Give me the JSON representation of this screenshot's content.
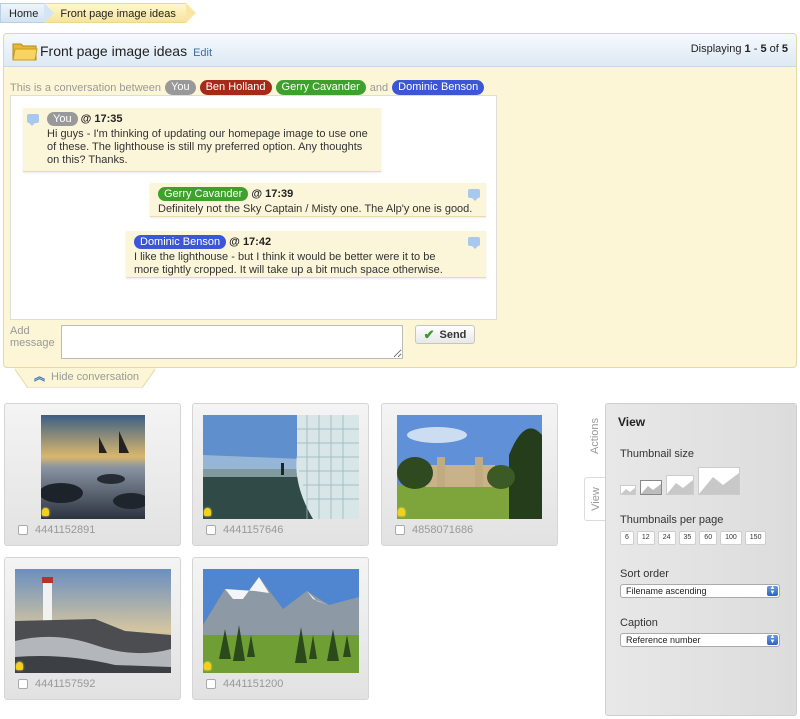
{
  "breadcrumb": {
    "home": "Home",
    "current": "Front page image ideas"
  },
  "conversation": {
    "title": "Front page image ideas",
    "edit_label": "Edit",
    "displaying_prefix": "Displaying",
    "displaying_from": "1",
    "displaying_dash": "-",
    "displaying_to": "5",
    "displaying_of": "of",
    "displaying_total": "5",
    "participants_intro": "This is a conversation between",
    "participants_and": "and",
    "participants": [
      {
        "name": "You",
        "color": "#999999"
      },
      {
        "name": "Ben Holland",
        "color": "#a52a1a"
      },
      {
        "name": "Gerry Cavander",
        "color": "#3fa12d"
      },
      {
        "name": "Dominic Benson",
        "color": "#3d56d6"
      }
    ],
    "messages": [
      {
        "author": "You",
        "time": "@ 17:35",
        "text": "Hi guys - I'm thinking of updating our homepage image to use one of these. The lighthouse is still my preferred option. Any thoughts on this? Thanks."
      },
      {
        "author": "Gerry Cavander",
        "time": "@ 17:39",
        "text": "Definitely not the Sky Captain / Misty one. The Alp'y one is good."
      },
      {
        "author": "Dominic Benson",
        "time": "@ 17:42",
        "text": "I like the lighthouse - but I think it would be better were it to be more tightly cropped. It will take up a bit much space otherwise."
      }
    ],
    "add_message_label": "Add message",
    "message_value": "",
    "send_label": "Send",
    "hide_label": "Hide conversation"
  },
  "thumbnails": [
    {
      "ref": "4441152891",
      "subject": "sailboats-sunset-rocks"
    },
    {
      "ref": "4441157646",
      "subject": "glass-block-building"
    },
    {
      "ref": "4858071686",
      "subject": "college-chapel-lawn"
    },
    {
      "ref": "4441157592",
      "subject": "lighthouse-coast"
    },
    {
      "ref": "4441151200",
      "subject": "alpine-mountains"
    }
  ],
  "side_tabs": {
    "actions": "Actions",
    "view": "View"
  },
  "view_panel": {
    "title": "View",
    "thumbnail_size_label": "Thumbnail size",
    "thumbnail_size_selected": 2,
    "per_page_label": "Thumbnails per page",
    "per_page_options": [
      "6",
      "12",
      "24",
      "35",
      "60",
      "100",
      "150"
    ],
    "sort_label": "Sort order",
    "sort_value": "Filename ascending",
    "caption_label": "Caption",
    "caption_value": "Reference number"
  },
  "colors": {
    "accent": "#3a6ea5",
    "panel_bg": "#fdf6d6",
    "bulb": "#f3d11a"
  }
}
